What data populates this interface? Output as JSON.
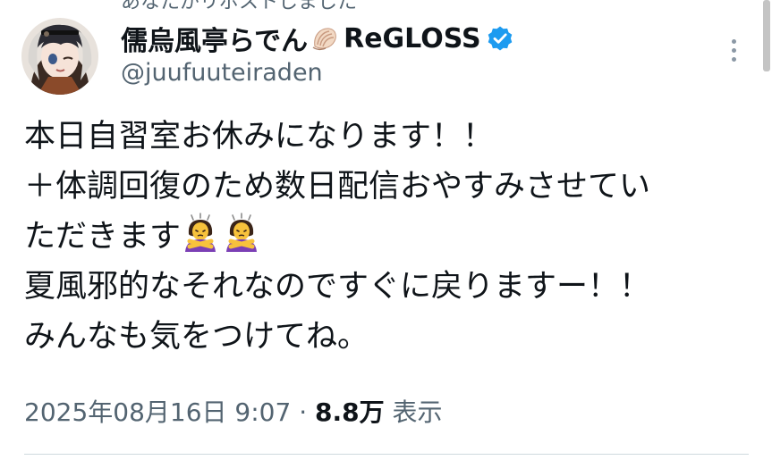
{
  "header_cut_text": "あなたがリポストしました",
  "author": {
    "display_name": "儒烏風亭らでん",
    "name_emoji": "shell-icon",
    "group": "ReGLOSS",
    "verified_icon": "verified-badge-icon",
    "handle": "@juufuuteiraden"
  },
  "tweet": {
    "lines": [
      "本日自習室お休みになります！！",
      "＋体調回復のため数日配信おやすみさせてい",
      "ただきます",
      "夏風邪的なそれなのですぐに戻りますー！！",
      "みんなも気をつけてね。"
    ],
    "line3_emojis": [
      "no-gesture-emoji",
      "no-gesture-emoji"
    ]
  },
  "meta": {
    "datetime": "2025年08月16日 9:07",
    "separator": "·",
    "views_count": "8.8万",
    "views_label": "表示"
  },
  "colors": {
    "text": "#0f1419",
    "secondary": "#536471",
    "verified": "#1d9bf0",
    "divider": "#cfd9de"
  }
}
